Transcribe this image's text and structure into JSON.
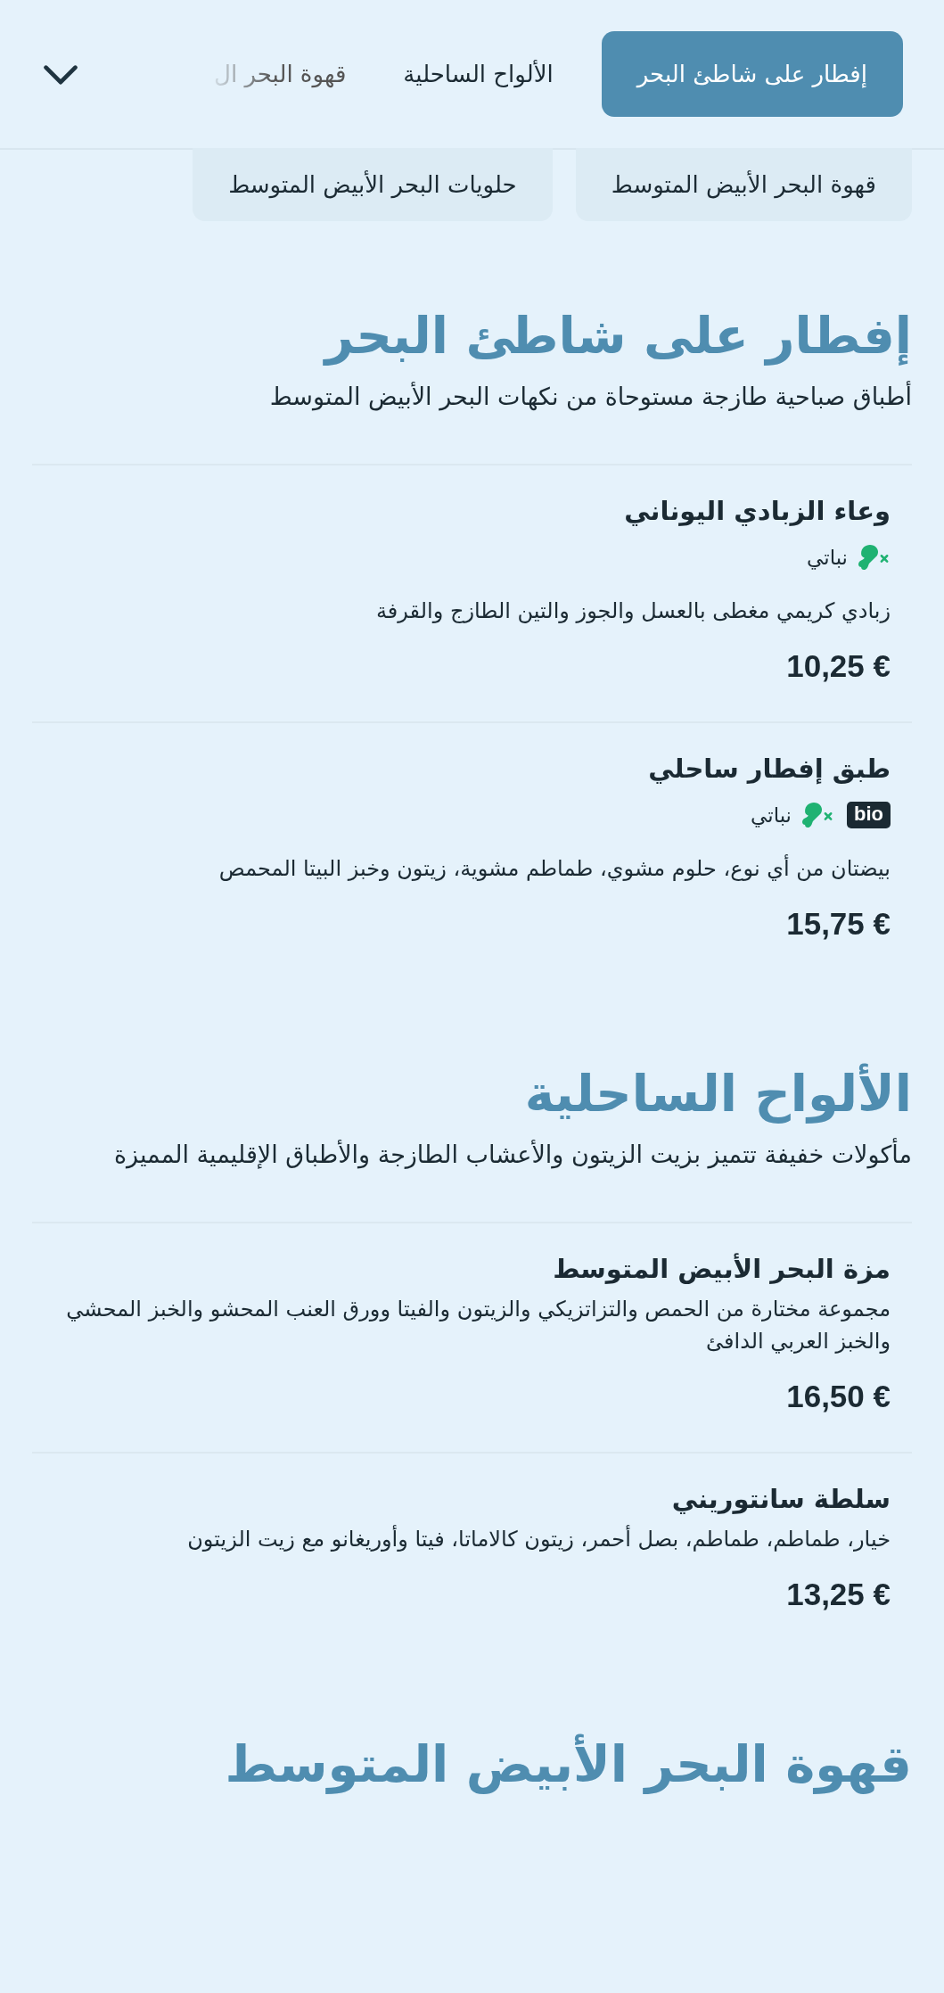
{
  "category_tabs": [
    {
      "label": "إفطار على شاطئ البحر",
      "selected": true
    },
    {
      "label": "الألواح الساحلية",
      "selected": false
    },
    {
      "label": "قهوة البحر ال",
      "selected": false
    }
  ],
  "category_chips": [
    {
      "label": "قهوة البحر الأبيض المتوسط"
    },
    {
      "label": "حلويات البحر الأبيض المتوسط"
    }
  ],
  "sections": [
    {
      "title": "إفطار على شاطئ البحر",
      "subtitle": "أطباق صباحية طازجة مستوحاة من نكهات البحر الأبيض المتوسط",
      "items": [
        {
          "name": "وعاء الزبادي اليوناني",
          "tags": [
            {
              "kind": "vegetarian",
              "text": "نباتي"
            }
          ],
          "description": "زبادي كريمي مغطى بالعسل والجوز والتين الطازج والقرفة",
          "price": "10,25 €"
        },
        {
          "name": "طبق إفطار ساحلي",
          "tags": [
            {
              "kind": "bio",
              "text": "bio"
            },
            {
              "kind": "vegetarian",
              "text": "نباتي"
            }
          ],
          "description": "بيضتان من أي نوع، حلوم مشوي، طماطم مشوية، زيتون وخبز البيتا المحمص",
          "price": "15,75 €"
        }
      ]
    },
    {
      "title": "الألواح الساحلية",
      "subtitle": "مأكولات خفيفة تتميز بزيت الزيتون والأعشاب الطازجة والأطباق الإقليمية المميزة",
      "items": [
        {
          "name": "مزة البحر الأبيض المتوسط",
          "description": "مجموعة مختارة من الحمص والتزاتزيكي والزيتون والفيتا وورق العنب المحشو والخبز المحشي والخبز العربي الدافئ",
          "price": "16,50 €"
        },
        {
          "name": "سلطة سانتوريني",
          "description": "خيار، طماطم، طماطم، بصل أحمر، زيتون كالاماتا، فيتا وأوريغانو مع زيت الزيتون",
          "price": "13,25 €"
        }
      ]
    },
    {
      "title": "قهوة البحر الأبيض المتوسط"
    }
  ]
}
